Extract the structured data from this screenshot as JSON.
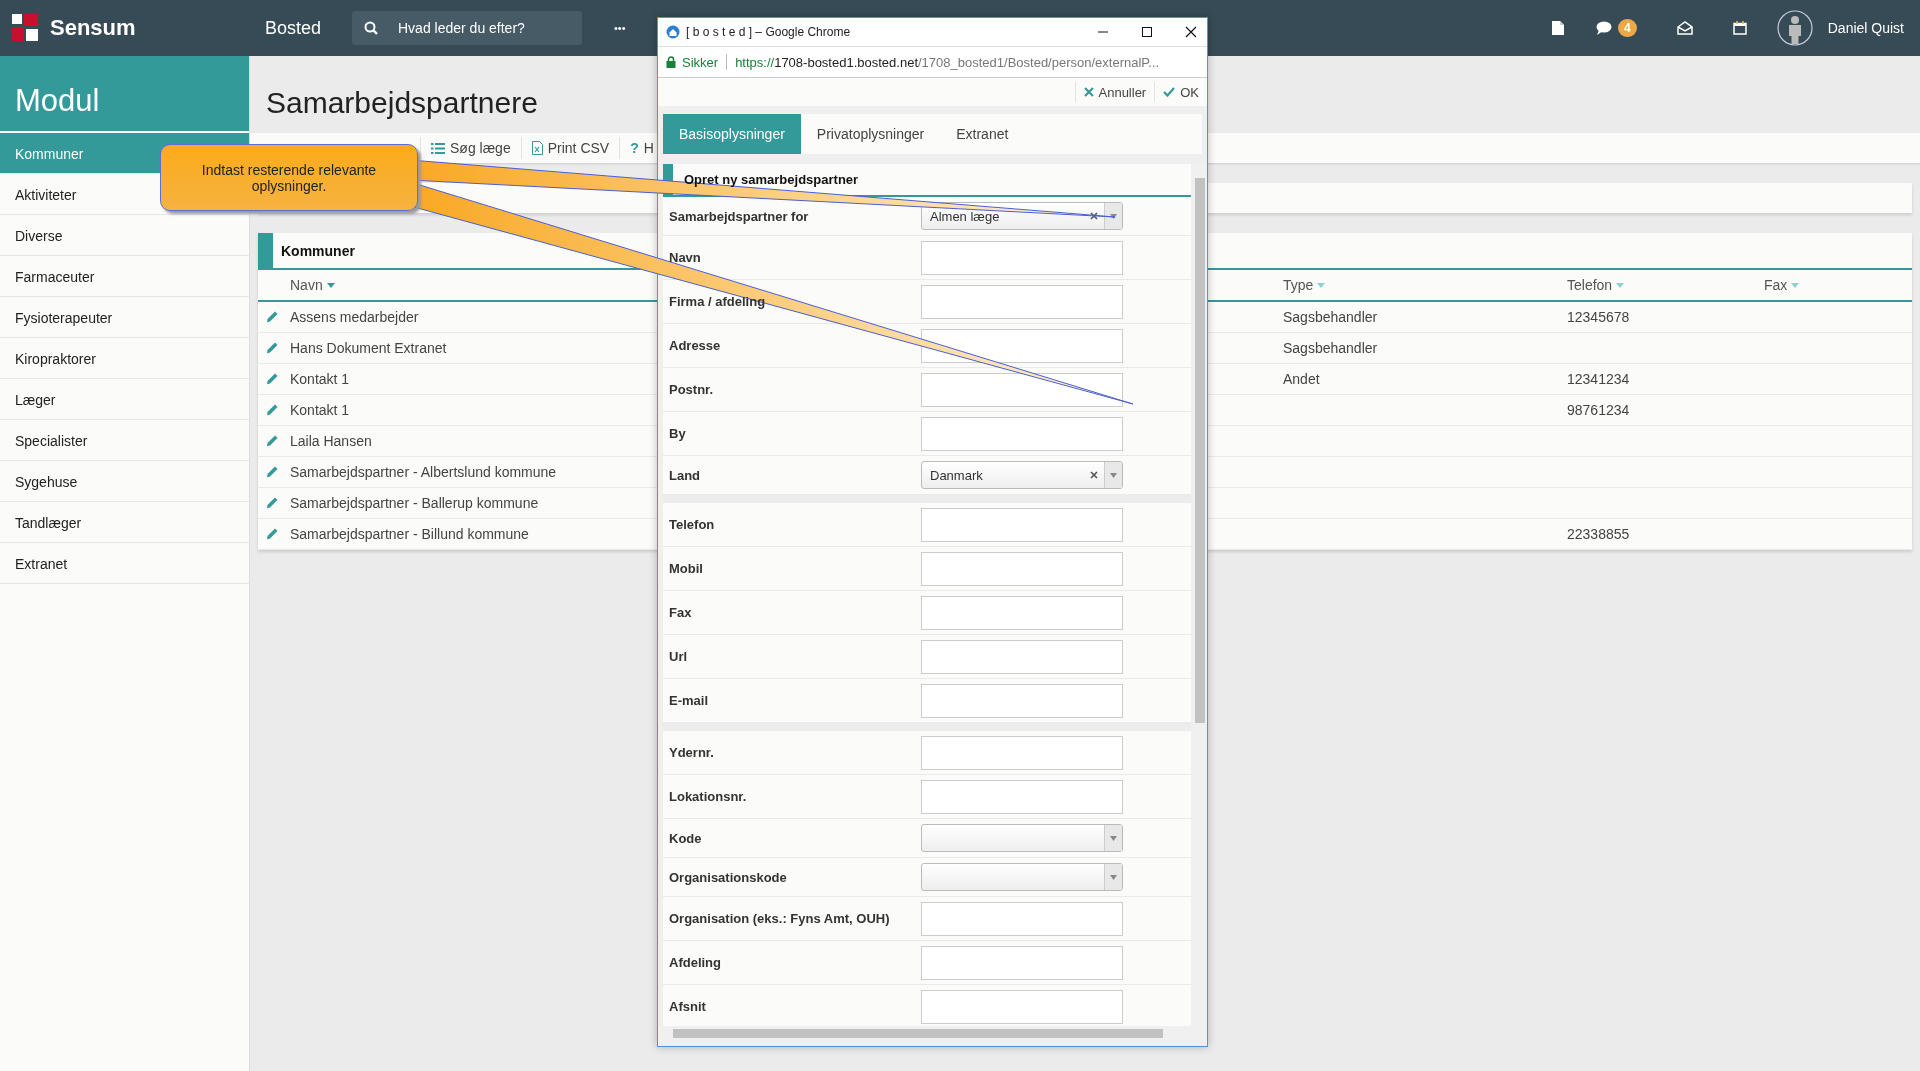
{
  "top_bar": {
    "brand": "Sensum",
    "module": "Bosted",
    "search": {
      "placeholder": "Hvad leder du efter?"
    },
    "more": "•••",
    "chat_badge": "4",
    "user": "Daniel Quist"
  },
  "sidebar": {
    "title": "Modul",
    "items": [
      {
        "label": "Kommuner",
        "selected": true
      },
      {
        "label": "Aktiviteter",
        "selected": false
      },
      {
        "label": "Diverse",
        "selected": false
      },
      {
        "label": "Farmaceuter",
        "selected": false
      },
      {
        "label": "Fysioterapeuter",
        "selected": false
      },
      {
        "label": "Kiropraktorer",
        "selected": false
      },
      {
        "label": "Læger",
        "selected": false
      },
      {
        "label": "Specialister",
        "selected": false
      },
      {
        "label": "Sygehuse",
        "selected": false
      },
      {
        "label": "Tandlæger",
        "selected": false
      },
      {
        "label": "Extranet",
        "selected": false
      }
    ]
  },
  "page": {
    "title": "Samarbejdspartnere",
    "toolbar": [
      {
        "kind": "list",
        "label": "Søg læge"
      },
      {
        "kind": "csv",
        "label": "Print CSV"
      },
      {
        "kind": "help",
        "icon": "?",
        "label": "H"
      }
    ]
  },
  "table": {
    "title": "Kommuner",
    "columns": [
      {
        "label": "Navn"
      },
      {
        "label": "Type"
      },
      {
        "label": "Telefon"
      },
      {
        "label": "Fax"
      }
    ],
    "rows": [
      {
        "navn": "Assens medarbejder",
        "type": "Sagsbehandler",
        "telefon": "12345678"
      },
      {
        "navn": "Hans Dokument Extranet",
        "type": "Sagsbehandler"
      },
      {
        "navn": "Kontakt 1",
        "type": "Andet",
        "telefon": "12341234"
      },
      {
        "navn": "Kontakt 1",
        "telefon": "98761234"
      },
      {
        "navn": "Laila Hansen"
      },
      {
        "navn": "Samarbejdspartner - Albertslund kommune"
      },
      {
        "navn": "Samarbejdspartner - Ballerup kommune"
      },
      {
        "navn": "Samarbejdspartner - Billund kommune",
        "telefon": "22338855"
      }
    ]
  },
  "callout": {
    "text": "Indtast resterende relevante oplysninger."
  },
  "popup": {
    "window_title": "[ b o s t e d ] – Google Chrome",
    "secure_label": "Sikker",
    "url_scheme": "https://",
    "url_host": "1708-bosted1.bosted.net",
    "url_path": "/1708_bosted1/Bosted/person/externalP...",
    "actions": [
      {
        "kind": "cancel",
        "label": "Annuller"
      },
      {
        "kind": "ok",
        "label": "OK"
      }
    ],
    "tabs": [
      {
        "label": "Basisoplysninger",
        "selected": true
      },
      {
        "label": "Privatoplysninger",
        "selected": false
      },
      {
        "label": "Extranet",
        "selected": false
      }
    ],
    "section_title": "Opret ny samarbejdspartner",
    "groups": [
      [
        {
          "label": "Samarbejdspartner for",
          "kind": "select",
          "value": "Almen læge",
          "clearable": true
        },
        {
          "label": "Navn",
          "kind": "text"
        },
        {
          "label": "Firma / afdeling",
          "kind": "text"
        },
        {
          "label": "Adresse",
          "kind": "text"
        },
        {
          "label": "Postnr.",
          "kind": "text"
        },
        {
          "label": "By",
          "kind": "text"
        },
        {
          "label": "Land",
          "kind": "select",
          "value": "Danmark",
          "clearable": true
        }
      ],
      [
        {
          "label": "Telefon",
          "kind": "text"
        },
        {
          "label": "Mobil",
          "kind": "text"
        },
        {
          "label": "Fax",
          "kind": "text"
        },
        {
          "label": "Url",
          "kind": "text"
        },
        {
          "label": "E-mail",
          "kind": "text"
        }
      ],
      [
        {
          "label": "Ydernr.",
          "kind": "text"
        },
        {
          "label": "Lokationsnr.",
          "kind": "text"
        },
        {
          "label": "Kode",
          "kind": "select",
          "clearable": false
        },
        {
          "label": "Organisationskode",
          "kind": "select",
          "clearable": false
        },
        {
          "label": "Organisation (eks.: Fyns Amt, OUH)",
          "kind": "text"
        },
        {
          "label": "Afdeling",
          "kind": "text"
        },
        {
          "label": "Afsnit",
          "kind": "text"
        }
      ]
    ]
  }
}
